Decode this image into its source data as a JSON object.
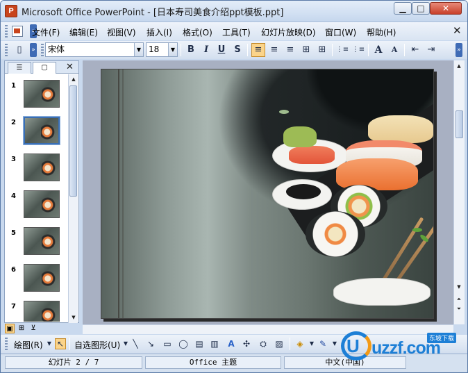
{
  "window": {
    "title": "Microsoft Office PowerPoint - [日本寿司美食介绍ppt模板.ppt]",
    "app_icon_letter": "P",
    "min_glyph": "▁",
    "max_glyph": "□",
    "close_glyph": "✕"
  },
  "menu": {
    "items": [
      "文件(F)",
      "编辑(E)",
      "视图(V)",
      "插入(I)",
      "格式(O)",
      "工具(T)",
      "幻灯片放映(D)",
      "窗口(W)",
      "帮助(H)"
    ],
    "close_glyph": "✕"
  },
  "format_toolbar": {
    "font_name": "宋体",
    "font_size": "18",
    "bold": "B",
    "italic": "I",
    "underline": "U",
    "shadow": "S",
    "align_left": "≡",
    "align_center": "≡",
    "align_right": "≡",
    "distribute": "⊞",
    "numbering": "⋮≡",
    "bullets": "⋮≡",
    "grow_font": "A",
    "shrink_font": "A",
    "decrease_indent": "⇤",
    "increase_indent": "⇥"
  },
  "slide_panel": {
    "tab_outline": "☰",
    "tab_slides": "▢",
    "close_glyph": "✕",
    "slides": [
      "1",
      "2",
      "3",
      "4",
      "5",
      "6",
      "7"
    ],
    "selected_index": 2
  },
  "drawing_toolbar": {
    "draw_label": "绘图(R)",
    "autoshapes_label": "自选图形(U)"
  },
  "status": {
    "slide": "幻灯片 2 / 7",
    "theme": "Office 主题",
    "language": "中文(中国)"
  },
  "watermark": {
    "brand": "uzzf.com",
    "badge": "东坡下载",
    "letter": "U"
  },
  "colors": {
    "accent": "#3f6bb5",
    "toolbar_active": "#fbd48a",
    "close_button": "#c8402a"
  }
}
